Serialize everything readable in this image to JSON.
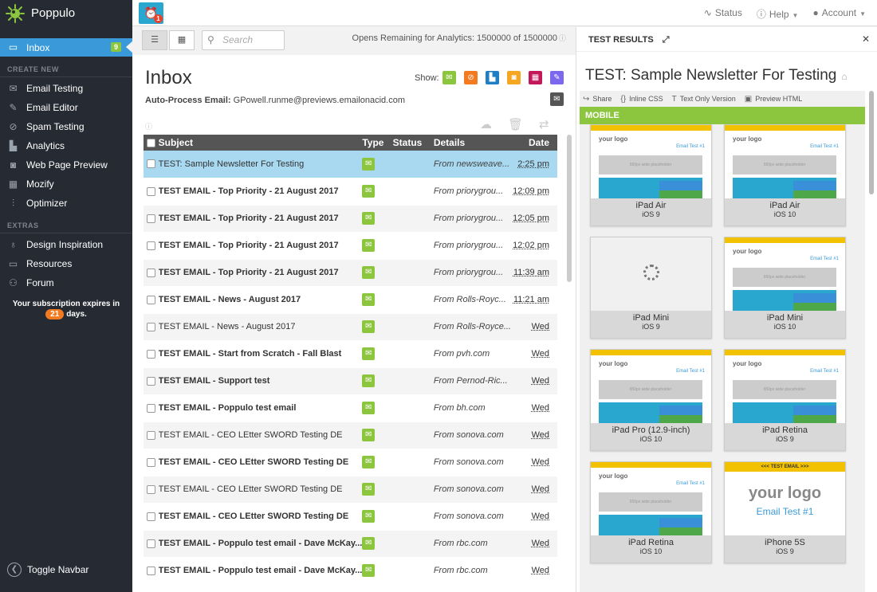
{
  "app": {
    "brand": "Poppulo"
  },
  "sidebar": {
    "inbox": {
      "label": "Inbox",
      "badge": "9"
    },
    "create_header": "CREATE NEW",
    "create_items": [
      {
        "label": "Email Testing",
        "icon": "envelope-icon"
      },
      {
        "label": "Email Editor",
        "icon": "edit-icon"
      },
      {
        "label": "Spam Testing",
        "icon": "ban-icon"
      },
      {
        "label": "Analytics",
        "icon": "bar-chart-icon"
      },
      {
        "label": "Web Page Preview",
        "icon": "camera-icon"
      },
      {
        "label": "Mozify",
        "icon": "grid-icon"
      },
      {
        "label": "Optimizer",
        "icon": "sliders-icon"
      }
    ],
    "extras_header": "EXTRAS",
    "extras_items": [
      {
        "label": "Design Inspiration",
        "icon": "lightbulb-icon"
      },
      {
        "label": "Resources",
        "icon": "folder-icon"
      },
      {
        "label": "Forum",
        "icon": "users-icon"
      }
    ],
    "subscription": {
      "text_before": "Your subscription expires in",
      "days": "21",
      "text_after": "days."
    },
    "toggle_label": "Toggle Navbar"
  },
  "topbar": {
    "alarm_badge": "1",
    "status_label": "Status",
    "help_label": "Help",
    "account_label": "Account"
  },
  "inbox": {
    "search_placeholder": "Search",
    "opens_text": "Opens Remaining for Analytics: 1500000 of 1500000",
    "title": "Inbox",
    "autoprocess_label": "Auto-Process Email:",
    "autoprocess_email": "GPowell.runme@previews.emailonacid.com",
    "show_label": "Show:",
    "show_filters": [
      {
        "icon": "envelope-icon",
        "color": "#8cc63f"
      },
      {
        "icon": "ban-icon",
        "color": "#f47a20"
      },
      {
        "icon": "bar-chart-icon",
        "color": "#1f7fc4"
      },
      {
        "icon": "camera-icon",
        "color": "#f5a623"
      },
      {
        "icon": "grid-icon",
        "color": "#c2185b"
      },
      {
        "icon": "edit-icon",
        "color": "#7b68ee"
      },
      {
        "icon": "envelope-dark-icon",
        "color": "#555555"
      }
    ],
    "columns": {
      "subject": "Subject",
      "type": "Type",
      "status": "Status",
      "details": "Details",
      "date": "Date"
    },
    "rows": [
      {
        "subject": "TEST: Sample Newsletter For Testing",
        "details": "From newsweave...",
        "date": "2:25 pm",
        "bold": false,
        "selected": true
      },
      {
        "subject": "TEST EMAIL - Top Priority - 21 August 2017",
        "details": "From priorygrou...",
        "date": "12:09 pm",
        "bold": true
      },
      {
        "subject": "TEST EMAIL - Top Priority - 21 August 2017",
        "details": "From priorygrou...",
        "date": "12:05 pm",
        "bold": true
      },
      {
        "subject": "TEST EMAIL - Top Priority - 21 August 2017",
        "details": "From priorygrou...",
        "date": "12:02 pm",
        "bold": true
      },
      {
        "subject": "TEST EMAIL - Top Priority - 21 August 2017",
        "details": "From priorygrou...",
        "date": "11:39 am",
        "bold": true
      },
      {
        "subject": "TEST EMAIL - News - August 2017",
        "details": "From Rolls-Royc...",
        "date": "11:21 am",
        "bold": true
      },
      {
        "subject": "TEST EMAIL - News - August 2017",
        "details": "From Rolls-Royce...",
        "date": "Wed",
        "bold": false
      },
      {
        "subject": "TEST EMAIL - Start from Scratch - Fall Blast",
        "details": "From pvh.com",
        "date": "Wed",
        "bold": true
      },
      {
        "subject": "TEST EMAIL - Support test",
        "details": "From Pernod-Ric...",
        "date": "Wed",
        "bold": true
      },
      {
        "subject": "TEST EMAIL - Poppulo test email",
        "details": "From bh.com",
        "date": "Wed",
        "bold": true
      },
      {
        "subject": "TEST EMAIL - CEO LEtter SWORD Testing DE",
        "details": "From sonova.com",
        "date": "Wed",
        "bold": false
      },
      {
        "subject": "TEST EMAIL - CEO LEtter SWORD Testing DE",
        "details": "From sonova.com",
        "date": "Wed",
        "bold": true
      },
      {
        "subject": "TEST EMAIL - CEO LEtter SWORD Testing DE",
        "details": "From sonova.com",
        "date": "Wed",
        "bold": false
      },
      {
        "subject": "TEST EMAIL - CEO LEtter SWORD Testing DE",
        "details": "From sonova.com",
        "date": "Wed",
        "bold": true
      },
      {
        "subject": "TEST EMAIL - Poppulo test email - Dave McKay...",
        "details": "From rbc.com",
        "date": "Wed",
        "bold": true
      },
      {
        "subject": "TEST EMAIL - Poppulo test email - Dave McKay...",
        "details": "From rbc.com",
        "date": "Wed",
        "bold": true
      }
    ]
  },
  "results": {
    "header": "TEST RESULTS",
    "title": "TEST: Sample Newsletter For Testing",
    "actions": [
      "Share",
      "Inline CSS",
      "Text Only Version",
      "Preview HTML"
    ],
    "section": "MOBILE",
    "mini": {
      "logo": "your logo",
      "link": "Email Test #1",
      "placeholder": "650px wide placeholder",
      "banner": "<<< TEST EMAIL >>>"
    },
    "cards": [
      {
        "device": "iPad Air",
        "os": "iOS 9",
        "kind": "normal"
      },
      {
        "device": "iPad Air",
        "os": "iOS 10",
        "kind": "normal"
      },
      {
        "device": "iPad Mini",
        "os": "iOS 9",
        "kind": "loading"
      },
      {
        "device": "iPad Mini",
        "os": "iOS 10",
        "kind": "normal"
      },
      {
        "device": "iPad Pro (12.9-inch)",
        "os": "iOS 10",
        "kind": "photo"
      },
      {
        "device": "iPad Retina",
        "os": "iOS 9",
        "kind": "normal"
      },
      {
        "device": "iPad Retina",
        "os": "iOS 10",
        "kind": "normal"
      },
      {
        "device": "iPhone 5S",
        "os": "iOS 9",
        "kind": "large"
      }
    ]
  }
}
